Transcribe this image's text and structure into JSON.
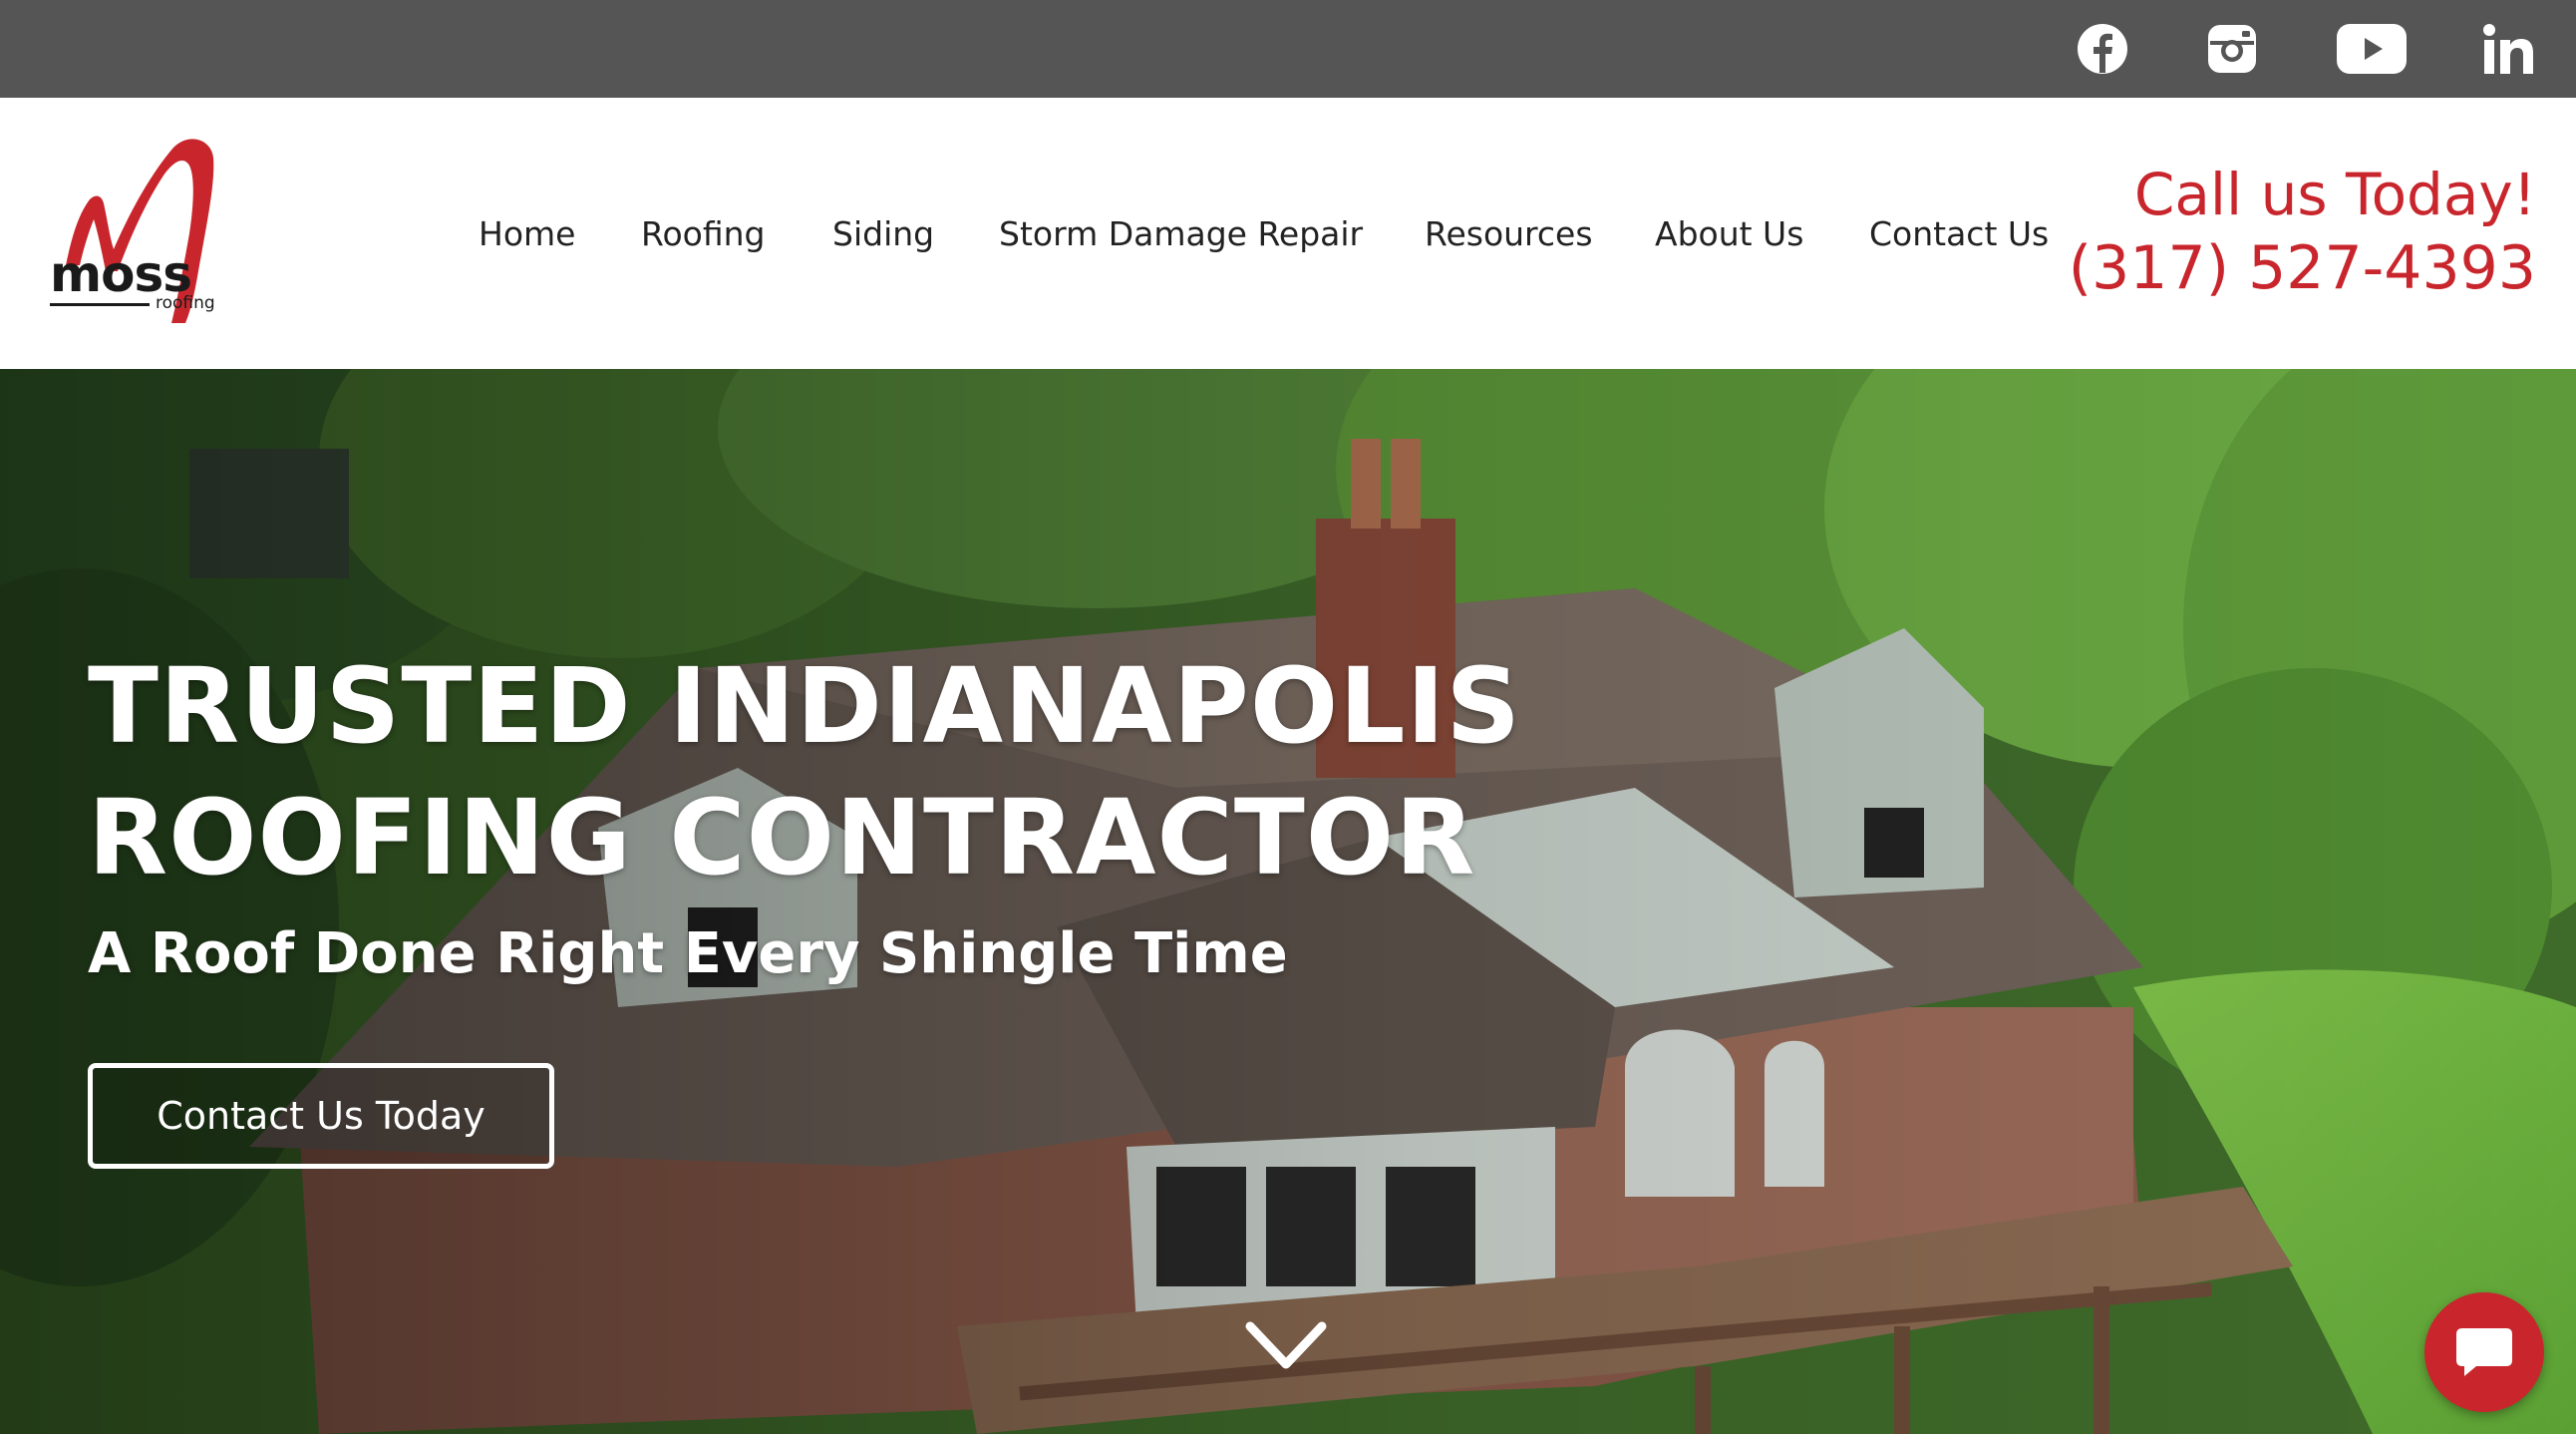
{
  "top_bar": {
    "background_color": "#555555",
    "social_icons": [
      "facebook-icon",
      "instagram-icon",
      "youtube-icon",
      "linkedin-icon"
    ]
  },
  "header": {
    "logo": {
      "main": "moss",
      "sub": "roofing",
      "accent_color": "#c8262c"
    },
    "nav": [
      "Home",
      "Roofing",
      "Siding",
      "Storm Damage Repair",
      "Resources",
      "About Us",
      "Contact Us"
    ],
    "call": {
      "label": "Call us Today!",
      "phone": "(317) 527-4393",
      "color": "#c8262c"
    }
  },
  "hero": {
    "title_line1": "TRUSTED INDIANAPOLIS",
    "title_line2": "ROOFING CONTRACTOR",
    "subtitle": "A Roof Done Right Every Shingle Time",
    "cta_label": "Contact Us Today",
    "scroll_icon": "chevron-down-icon"
  },
  "chat_widget": {
    "icon": "chat-bubble-icon",
    "color": "#c8262c"
  }
}
